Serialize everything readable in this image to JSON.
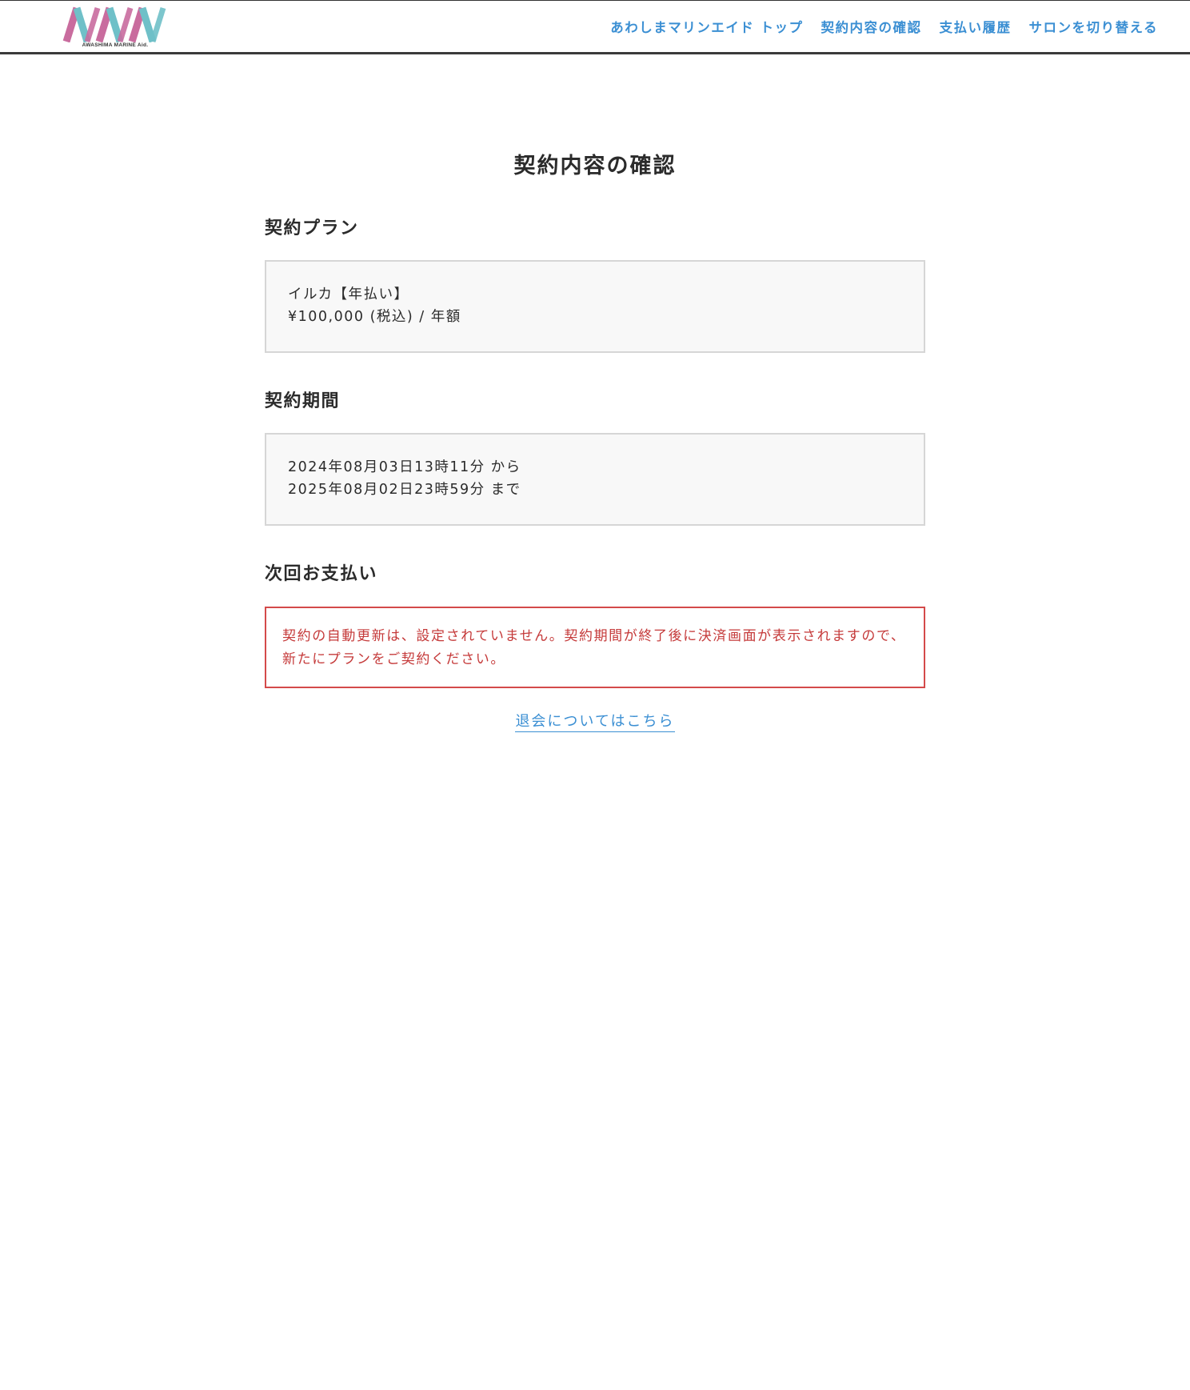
{
  "header": {
    "logo_text": "AWASHIMA MARINE Aid.",
    "colors": {
      "logo_pink": "#c96c9e",
      "logo_teal": "#6fc0c8",
      "link_blue": "#3b8fd3",
      "alert_red": "#c53a3a"
    },
    "nav": [
      {
        "label": "あわしまマリンエイド トップ"
      },
      {
        "label": "契約内容の確認"
      },
      {
        "label": "支払い履歴"
      },
      {
        "label": "サロンを切り替える"
      }
    ]
  },
  "main": {
    "title": "契約内容の確認",
    "plan": {
      "heading": "契約プラン",
      "name": "イルカ【年払い】",
      "price": "¥100,000 (税込) / 年額"
    },
    "period": {
      "heading": "契約期間",
      "start": "2024年08月03日13時11分 から",
      "end": "2025年08月02日23時59分 まで"
    },
    "next_payment": {
      "heading": "次回お支払い",
      "notice": "契約の自動更新は、設定されていません。契約期間が終了後に決済画面が表示されますので、新たにプランをご契約ください。"
    },
    "withdraw_link": "退会についてはこちら"
  }
}
